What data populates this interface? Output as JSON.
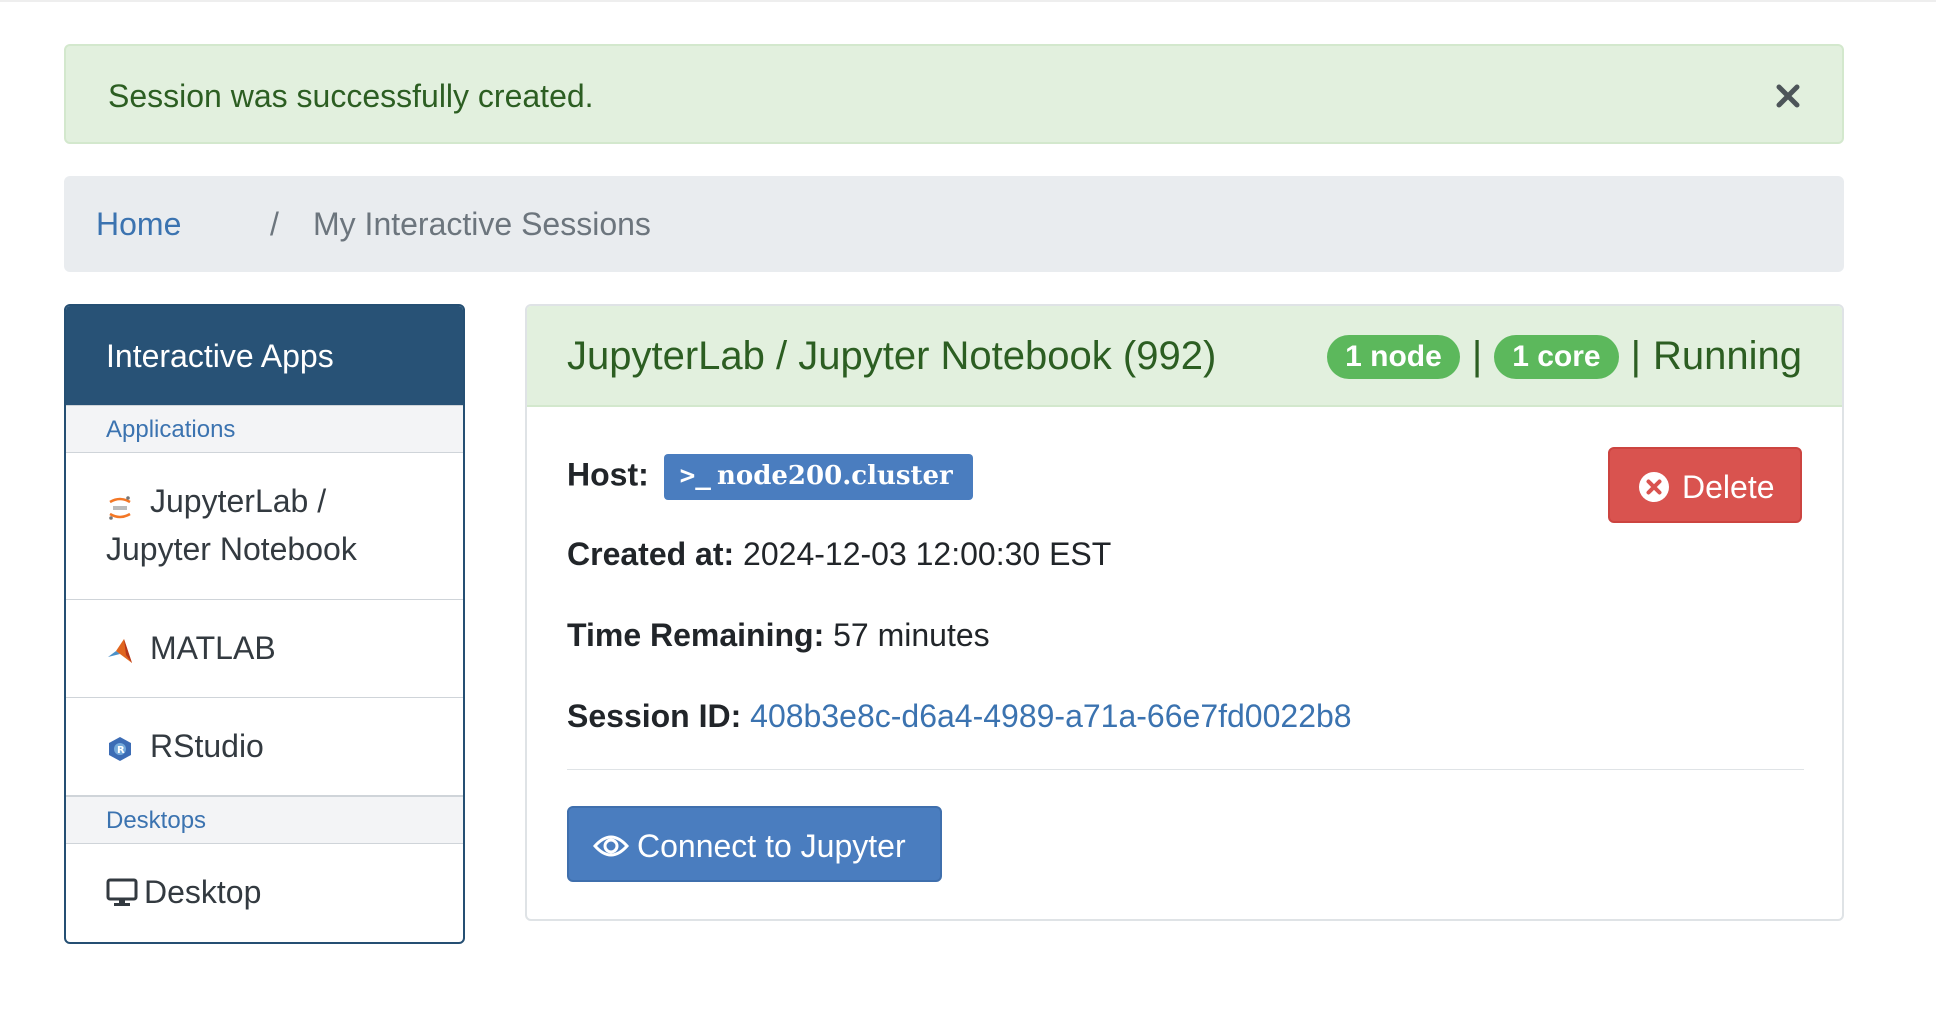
{
  "alert": {
    "message": "Session was successfully created.",
    "close_icon": "close-icon"
  },
  "breadcrumb": {
    "home": "Home",
    "separator": "/",
    "current": "My Interactive Sessions"
  },
  "sidebar": {
    "header": "Interactive Apps",
    "categories": [
      {
        "label": "Applications"
      },
      {
        "label": "Desktops"
      }
    ],
    "items": [
      {
        "line1": "JupyterLab /",
        "line2": "Jupyter Notebook",
        "icon": "jupyter-icon"
      },
      {
        "label": "MATLAB",
        "icon": "matlab-icon"
      },
      {
        "label": "RStudio",
        "icon": "rstudio-icon"
      },
      {
        "label": "Desktop",
        "icon": "monitor-icon"
      }
    ]
  },
  "session": {
    "title": "JupyterLab / Jupyter Notebook (992)",
    "nodes": "1 node",
    "cores": "1 core",
    "separator": "|",
    "status": "Running",
    "host_label": "Host:",
    "host_prompt": ">_",
    "host": "node200.cluster",
    "created_label": "Created at:",
    "created": "2024-12-03 12:00:30 EST",
    "remaining_label": "Time Remaining:",
    "remaining": "57 minutes",
    "sid_label": "Session ID:",
    "sid": "408b3e8c-d6a4-4989-a71a-66e7fd0022b8",
    "delete_label": "Delete",
    "connect_label": "Connect to Jupyter"
  },
  "colors": {
    "success_bg": "#e2f0de",
    "success_text": "#2c5e22",
    "primary": "#4a7dbf",
    "danger": "#d9534f",
    "sidebar_header": "#285276",
    "badge_green": "#5cb85c"
  }
}
